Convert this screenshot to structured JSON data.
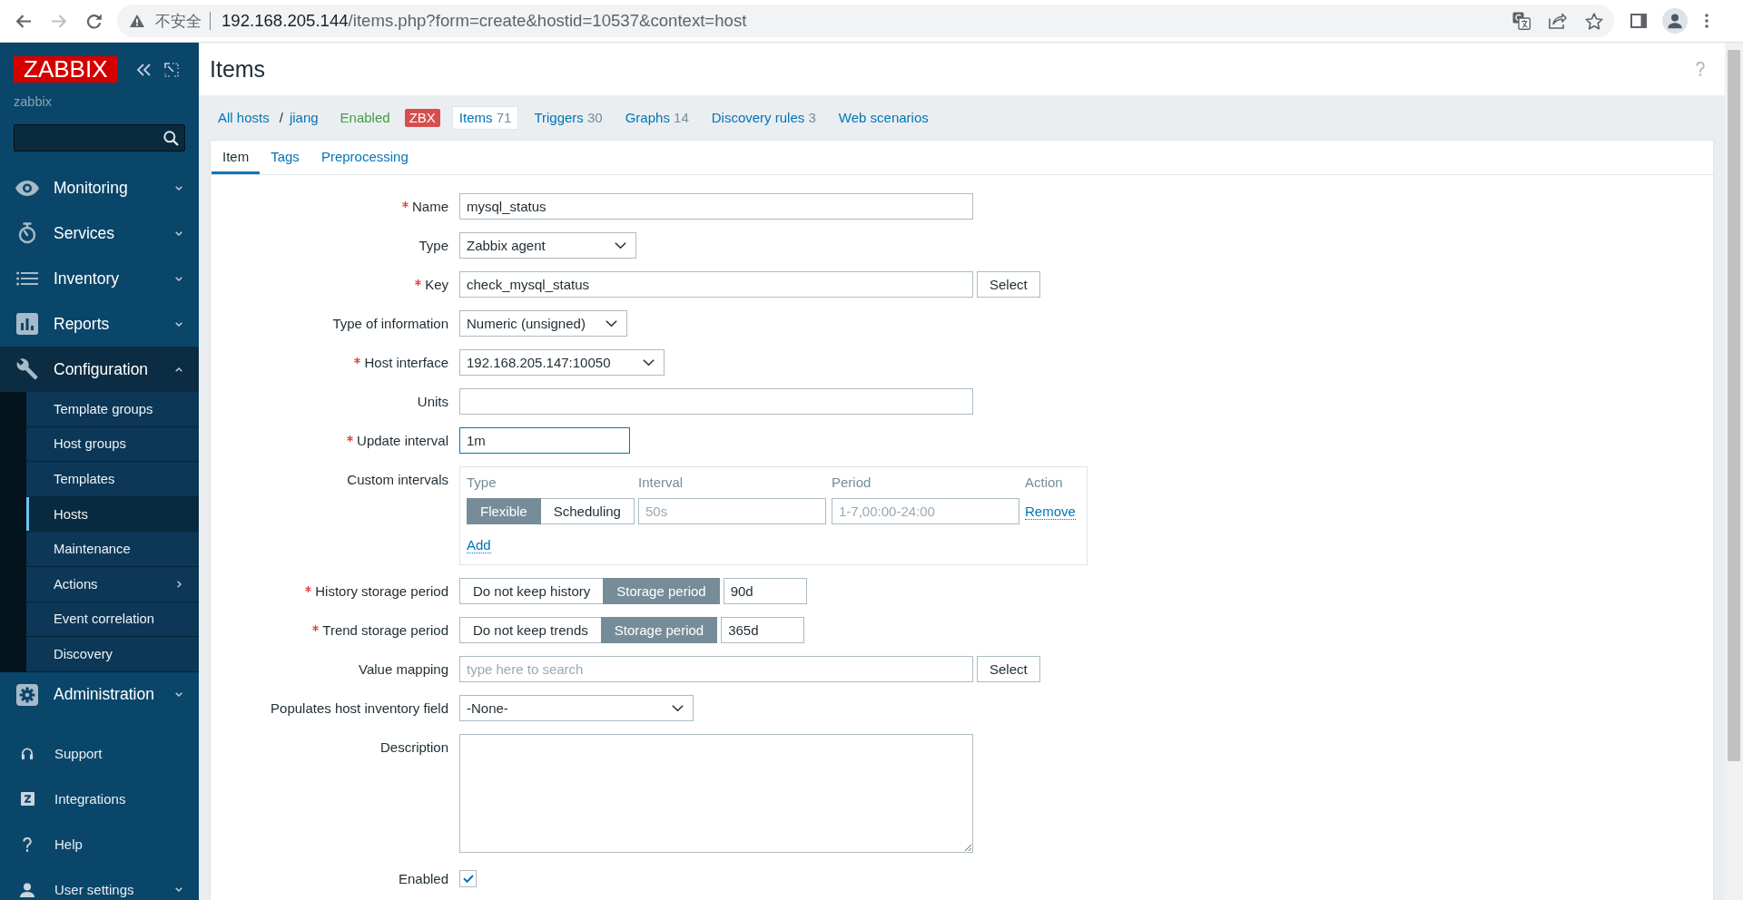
{
  "browser": {
    "security_label": "不安全",
    "url_host": "192.168.205.144",
    "url_path": "/items.php?form=create&hostid=10537&context=host",
    "can_go_forward": false
  },
  "sidebar": {
    "logo": "ZABBIX",
    "server_name": "zabbix",
    "menu": [
      {
        "label": "Monitoring",
        "expanded": false
      },
      {
        "label": "Services",
        "expanded": false
      },
      {
        "label": "Inventory",
        "expanded": false
      },
      {
        "label": "Reports",
        "expanded": false
      },
      {
        "label": "Configuration",
        "expanded": true,
        "children": [
          {
            "label": "Template groups",
            "selected": false,
            "has_submenu": false
          },
          {
            "label": "Host groups",
            "selected": false,
            "has_submenu": false
          },
          {
            "label": "Templates",
            "selected": false,
            "has_submenu": false
          },
          {
            "label": "Hosts",
            "selected": true,
            "has_submenu": false
          },
          {
            "label": "Maintenance",
            "selected": false,
            "has_submenu": false
          },
          {
            "label": "Actions",
            "selected": false,
            "has_submenu": true
          },
          {
            "label": "Event correlation",
            "selected": false,
            "has_submenu": false
          },
          {
            "label": "Discovery",
            "selected": false,
            "has_submenu": false
          }
        ]
      },
      {
        "label": "Administration",
        "expanded": false
      }
    ],
    "footer_menu": [
      {
        "label": "Support",
        "kind": "link"
      },
      {
        "label": "Integrations",
        "kind": "link"
      },
      {
        "label": "Help",
        "kind": "link"
      },
      {
        "label": "User settings",
        "kind": "submenu",
        "expanded": false
      }
    ]
  },
  "header": {
    "title": "Items"
  },
  "host_nav": {
    "breadcrumbs": [
      "All hosts",
      "jiang"
    ],
    "separator": "/",
    "status": "Enabled",
    "interface_badge": "ZBX",
    "tabs": [
      {
        "label": "Items",
        "count": "71",
        "selected": true
      },
      {
        "label": "Triggers",
        "count": "30",
        "selected": false
      },
      {
        "label": "Graphs",
        "count": "14",
        "selected": false
      },
      {
        "label": "Discovery rules",
        "count": "3",
        "selected": false
      },
      {
        "label": "Web scenarios",
        "selected": false
      }
    ]
  },
  "form": {
    "tabs": [
      {
        "label": "Item",
        "selected": true
      },
      {
        "label": "Tags",
        "selected": false
      },
      {
        "label": "Preprocessing",
        "selected": false
      }
    ],
    "fields": [
      {
        "kind": "text",
        "label": "Name",
        "required": true,
        "value": "mysql_status",
        "focused": false
      },
      {
        "kind": "select",
        "label": "Type",
        "required": false,
        "value": "Zabbix agent"
      },
      {
        "kind": "text_button",
        "label": "Key",
        "required": true,
        "value": "check_mysql_status",
        "button": "Select",
        "focused": false
      },
      {
        "kind": "select",
        "label": "Type of information",
        "required": false,
        "value": "Numeric (unsigned)"
      },
      {
        "kind": "select",
        "label": "Host interface",
        "required": true,
        "value": "192.168.205.147:10050"
      },
      {
        "kind": "text",
        "label": "Units",
        "required": false,
        "focused": false
      },
      {
        "kind": "text",
        "label": "Update interval",
        "required": true,
        "value": "1m",
        "focused": true
      },
      {
        "kind": "intervals",
        "label": "Custom intervals",
        "required": false,
        "columns": [
          "Type",
          "Interval",
          "Period",
          "Action"
        ],
        "rows": [
          {
            "modes": [
              {
                "label": "Flexible",
                "selected": true
              },
              {
                "label": "Scheduling",
                "selected": false
              }
            ],
            "interval": {
              "placeholder": "50s"
            },
            "period": {
              "placeholder": "1-7,00:00-24:00"
            },
            "action": "Remove"
          }
        ],
        "add": "Add"
      },
      {
        "kind": "storage",
        "label": "History storage period",
        "required": true,
        "modes": [
          {
            "label": "Do not keep history",
            "selected": false
          },
          {
            "label": "Storage period",
            "selected": true
          }
        ],
        "value": "90d"
      },
      {
        "kind": "storage",
        "label": "Trend storage period",
        "required": true,
        "modes": [
          {
            "label": "Do not keep trends",
            "selected": false
          },
          {
            "label": "Storage period",
            "selected": true
          }
        ],
        "value": "365d"
      },
      {
        "kind": "text_button",
        "label": "Value mapping",
        "required": false,
        "placeholder": "type here to search",
        "button": "Select",
        "focused": false
      },
      {
        "kind": "select",
        "label": "Populates host inventory field",
        "required": false,
        "value": "-None-"
      },
      {
        "kind": "textarea",
        "label": "Description",
        "required": false
      },
      {
        "kind": "checkbox",
        "label": "Enabled",
        "required": false,
        "checked": true
      }
    ]
  }
}
